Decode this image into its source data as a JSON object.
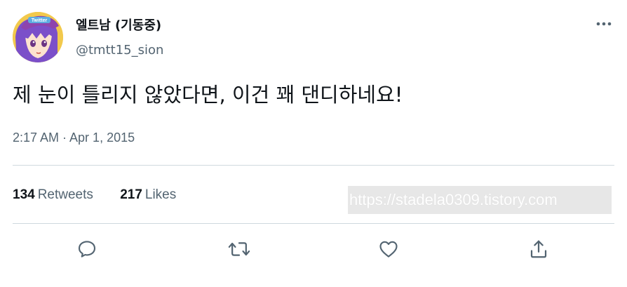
{
  "author": {
    "display_name": "엘트남 (기동중)",
    "handle": "@tmtt15_sion",
    "avatar_banner_text": "Twitter"
  },
  "tweet": {
    "text": "제 눈이 틀리지 않았다면, 이건 꽤 댄디하네요!",
    "timestamp": "2:17 AM · Apr 1, 2015"
  },
  "stats": {
    "retweets_count": "134",
    "retweets_label": "Retweets",
    "likes_count": "217",
    "likes_label": "Likes"
  },
  "watermark": {
    "text": "https://stadela0309.tistory.com"
  },
  "icons": {
    "more": "more-horizontal-icon",
    "reply": "reply-icon",
    "retweet": "retweet-icon",
    "like": "heart-icon",
    "share": "share-icon"
  },
  "colors": {
    "text_primary": "#0f1419",
    "text_secondary": "#536471",
    "divider": "#cfd9de",
    "avatar_background": "#f2c94c",
    "avatar_hair": "#7b4fc9"
  }
}
